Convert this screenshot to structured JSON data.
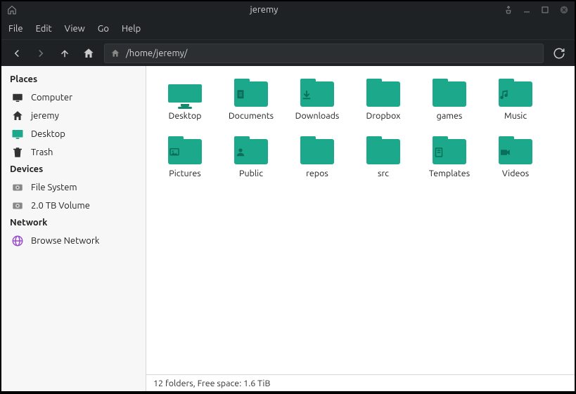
{
  "titlebar": {
    "title": "jeremy"
  },
  "menubar": {
    "items": [
      "File",
      "Edit",
      "View",
      "Go",
      "Help"
    ]
  },
  "toolbar": {
    "path": "/home/jeremy/"
  },
  "sidebar": {
    "sections": [
      {
        "header": "Places",
        "items": [
          {
            "label": "Computer",
            "icon": "computer"
          },
          {
            "label": "jeremy",
            "icon": "home"
          },
          {
            "label": "Desktop",
            "icon": "desktop"
          },
          {
            "label": "Trash",
            "icon": "trash"
          }
        ]
      },
      {
        "header": "Devices",
        "items": [
          {
            "label": "File System",
            "icon": "disk"
          },
          {
            "label": "2.0 TB Volume",
            "icon": "disk"
          }
        ]
      },
      {
        "header": "Network",
        "items": [
          {
            "label": "Browse Network",
            "icon": "network"
          }
        ]
      }
    ]
  },
  "folders": [
    {
      "name": "Desktop",
      "glyph": "desktop"
    },
    {
      "name": "Documents",
      "glyph": "doc"
    },
    {
      "name": "Downloads",
      "glyph": "download"
    },
    {
      "name": "Dropbox",
      "glyph": ""
    },
    {
      "name": "games",
      "glyph": ""
    },
    {
      "name": "Music",
      "glyph": "music"
    },
    {
      "name": "Pictures",
      "glyph": "picture"
    },
    {
      "name": "Public",
      "glyph": "public"
    },
    {
      "name": "repos",
      "glyph": ""
    },
    {
      "name": "src",
      "glyph": ""
    },
    {
      "name": "Templates",
      "glyph": "template"
    },
    {
      "name": "Videos",
      "glyph": "video"
    }
  ],
  "status": {
    "text": "12 folders, Free space: 1.6 TiB"
  }
}
